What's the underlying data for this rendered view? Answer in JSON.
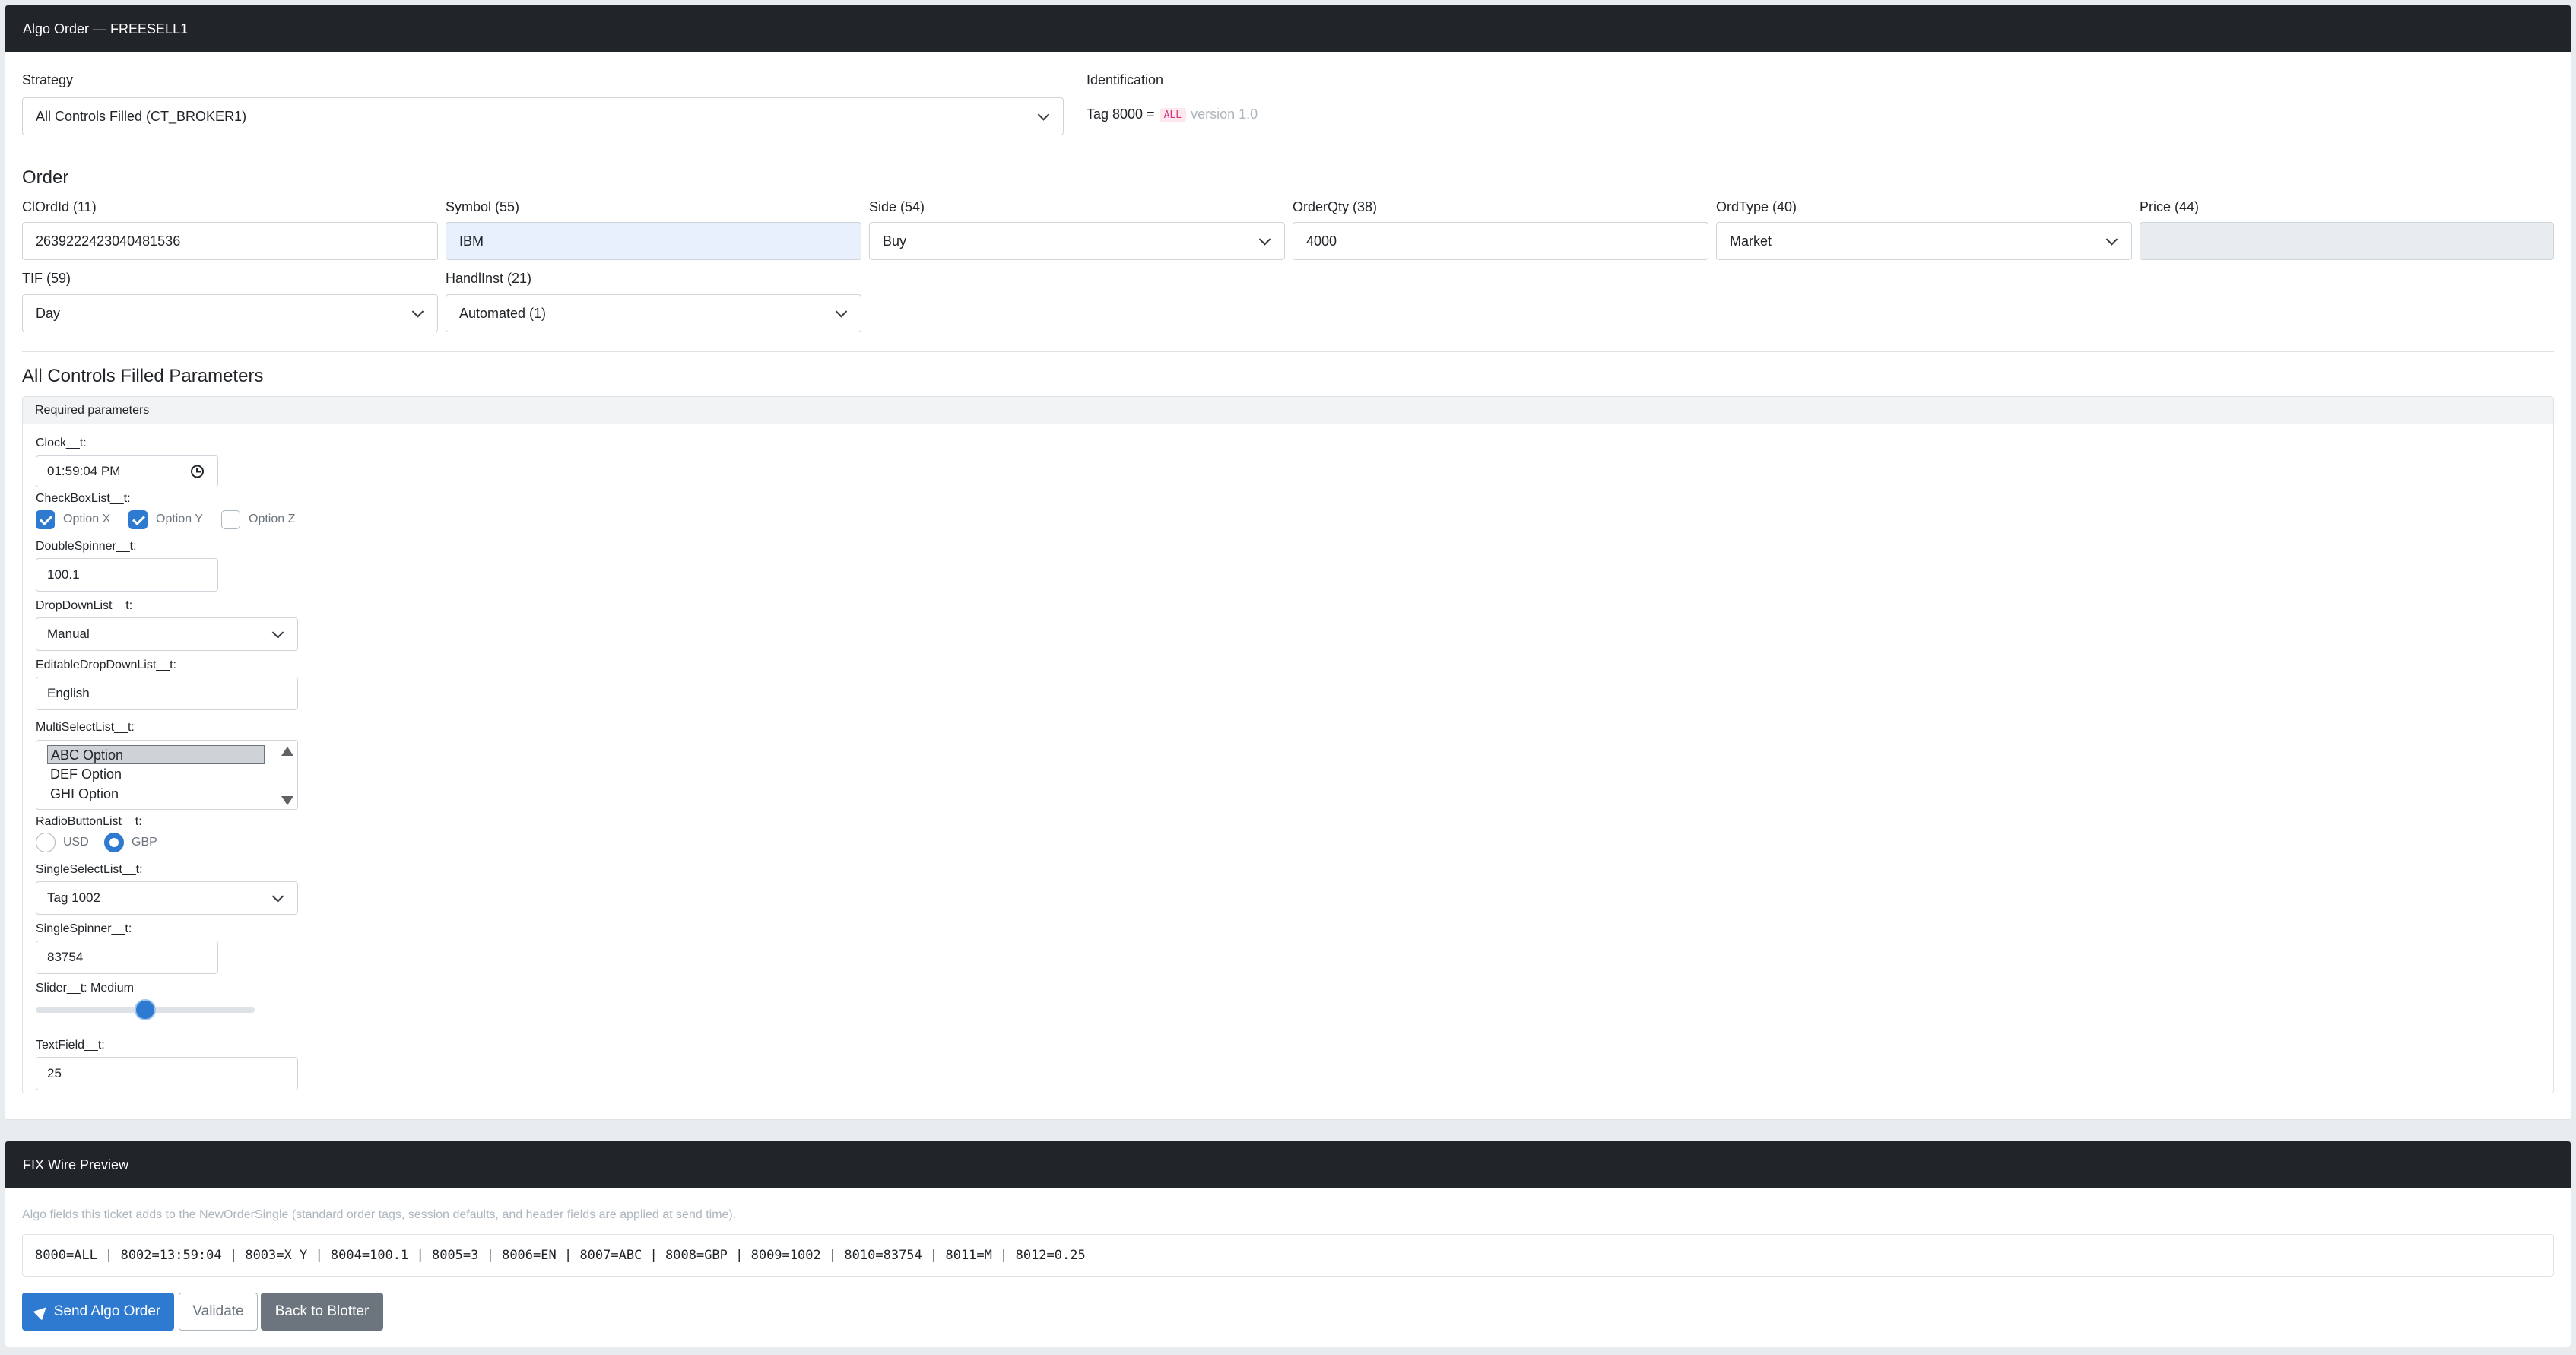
{
  "header": {
    "title": "Algo Order — FREESELL1"
  },
  "strategy": {
    "label": "Strategy",
    "selected": "All Controls Filled (CT_BROKER1)"
  },
  "identification": {
    "label": "Identification",
    "tag_text": "Tag 8000 =",
    "tag_value": "ALL",
    "version": "version 1.0"
  },
  "order": {
    "title": "Order",
    "clordid": {
      "label": "ClOrdId (11)",
      "value": "263922242304048153​6"
    },
    "symbol": {
      "label": "Symbol (55)",
      "value": "IBM"
    },
    "side": {
      "label": "Side (54)",
      "value": "Buy"
    },
    "orderqty": {
      "label": "OrderQty (38)",
      "value": "4000"
    },
    "ordtype": {
      "label": "OrdType (40)",
      "value": "Market"
    },
    "price": {
      "label": "Price (44)",
      "value": ""
    },
    "tif": {
      "label": "TIF (59)",
      "value": "Day"
    },
    "handlinst": {
      "label": "HandlInst (21)",
      "value": "Automated (1)"
    }
  },
  "params": {
    "title": "All Controls Filled Parameters",
    "required_header": "Required parameters",
    "clock": {
      "label": "Clock__t:",
      "value": "01:59:04 PM"
    },
    "checkbox": {
      "label": "CheckBoxList__t:",
      "options": [
        {
          "label": "Option X",
          "checked": true
        },
        {
          "label": "Option Y",
          "checked": true
        },
        {
          "label": "Option Z",
          "checked": false
        }
      ]
    },
    "double_spinner": {
      "label": "DoubleSpinner__t:",
      "value": "100.1"
    },
    "dropdown": {
      "label": "DropDownList__t:",
      "value": "Manual"
    },
    "editable_dropdown": {
      "label": "EditableDropDownList__t:",
      "value": "English"
    },
    "multiselect": {
      "label": "MultiSelectList__t:",
      "options": [
        "ABC Option",
        "DEF Option",
        "GHI Option"
      ],
      "selected": "ABC Option"
    },
    "radio": {
      "label": "RadioButtonList__t:",
      "options": [
        {
          "label": "USD",
          "checked": false
        },
        {
          "label": "GBP",
          "checked": true
        }
      ]
    },
    "single_select": {
      "label": "SingleSelectList__t:",
      "value": "Tag 1002"
    },
    "single_spinner": {
      "label": "SingleSpinner__t:",
      "value": "83754"
    },
    "slider": {
      "label": "Slider__t: Medium",
      "position": 0.5
    },
    "text_field": {
      "label": "TextField__t:",
      "value": "25"
    }
  },
  "fix": {
    "header": "FIX Wire Preview",
    "note": "Algo fields this ticket adds to the NewOrderSingle (standard order tags, session defaults, and header fields are applied at send time).",
    "wire": "8000=ALL | 8002=13:59:04 | 8003=X Y | 8004=100.1 | 8005=3 | 8006=EN | 8007=ABC | 8008=GBP | 8009=1002 | 8010=83754 | 8011=M | 8012=0.25"
  },
  "buttons": {
    "send": "Send Algo Order",
    "validate": "Validate",
    "back": "Back to Blotter"
  },
  "colors": {
    "header_bg": "#212529",
    "primary": "#2e7ad1",
    "secondary": "#6c757d",
    "badge_text": "#d63384"
  }
}
